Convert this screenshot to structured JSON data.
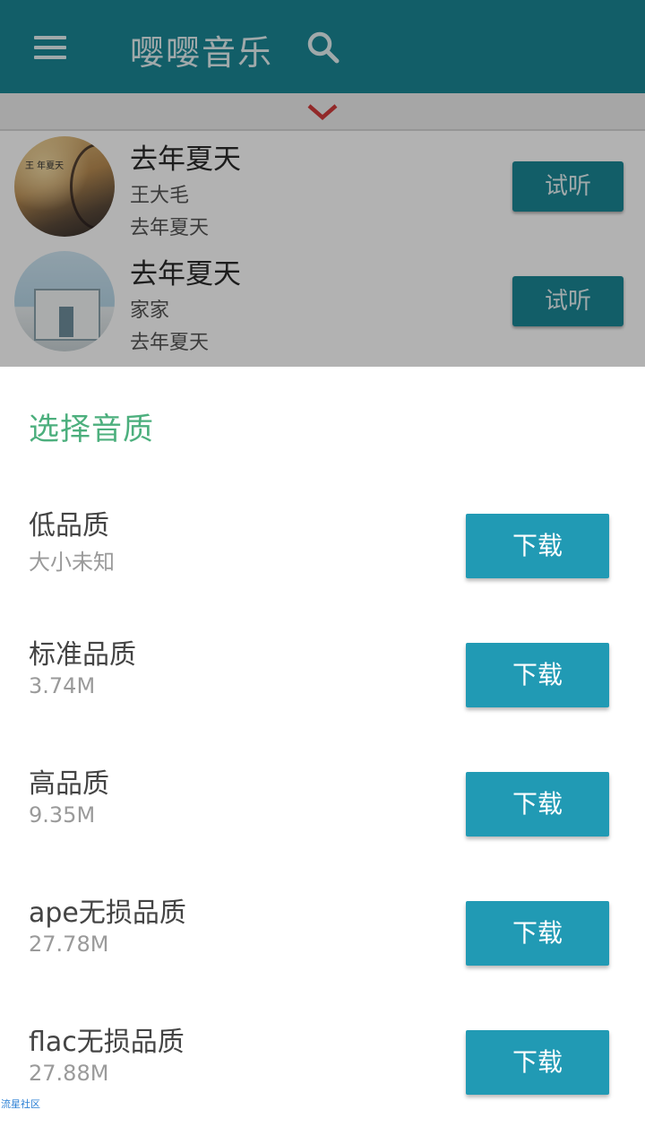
{
  "app": {
    "title": "嘤嘤音乐",
    "accent": "#1a8796"
  },
  "songs": [
    {
      "title": "去年夏天",
      "artist": "王大毛",
      "album": "去年夏天",
      "action": "试听",
      "cover_icon": "album-cover"
    },
    {
      "title": "去年夏天",
      "artist": "家家",
      "album": "去年夏天",
      "action": "试听",
      "cover_icon": "album-cover"
    }
  ],
  "sheet": {
    "title": "选择音质",
    "title_color": "#4caf7d",
    "button_color": "#219ab4",
    "options": [
      {
        "name": "低品质",
        "size": "大小未知",
        "action": "下载"
      },
      {
        "name": "标准品质",
        "size": "3.74M",
        "action": "下载"
      },
      {
        "name": "高品质",
        "size": "9.35M",
        "action": "下载"
      },
      {
        "name": "ape无损品质",
        "size": "27.78M",
        "action": "下载"
      },
      {
        "name": "flac无损品质",
        "size": "27.88M",
        "action": "下载"
      }
    ]
  },
  "watermark": "流星社区"
}
